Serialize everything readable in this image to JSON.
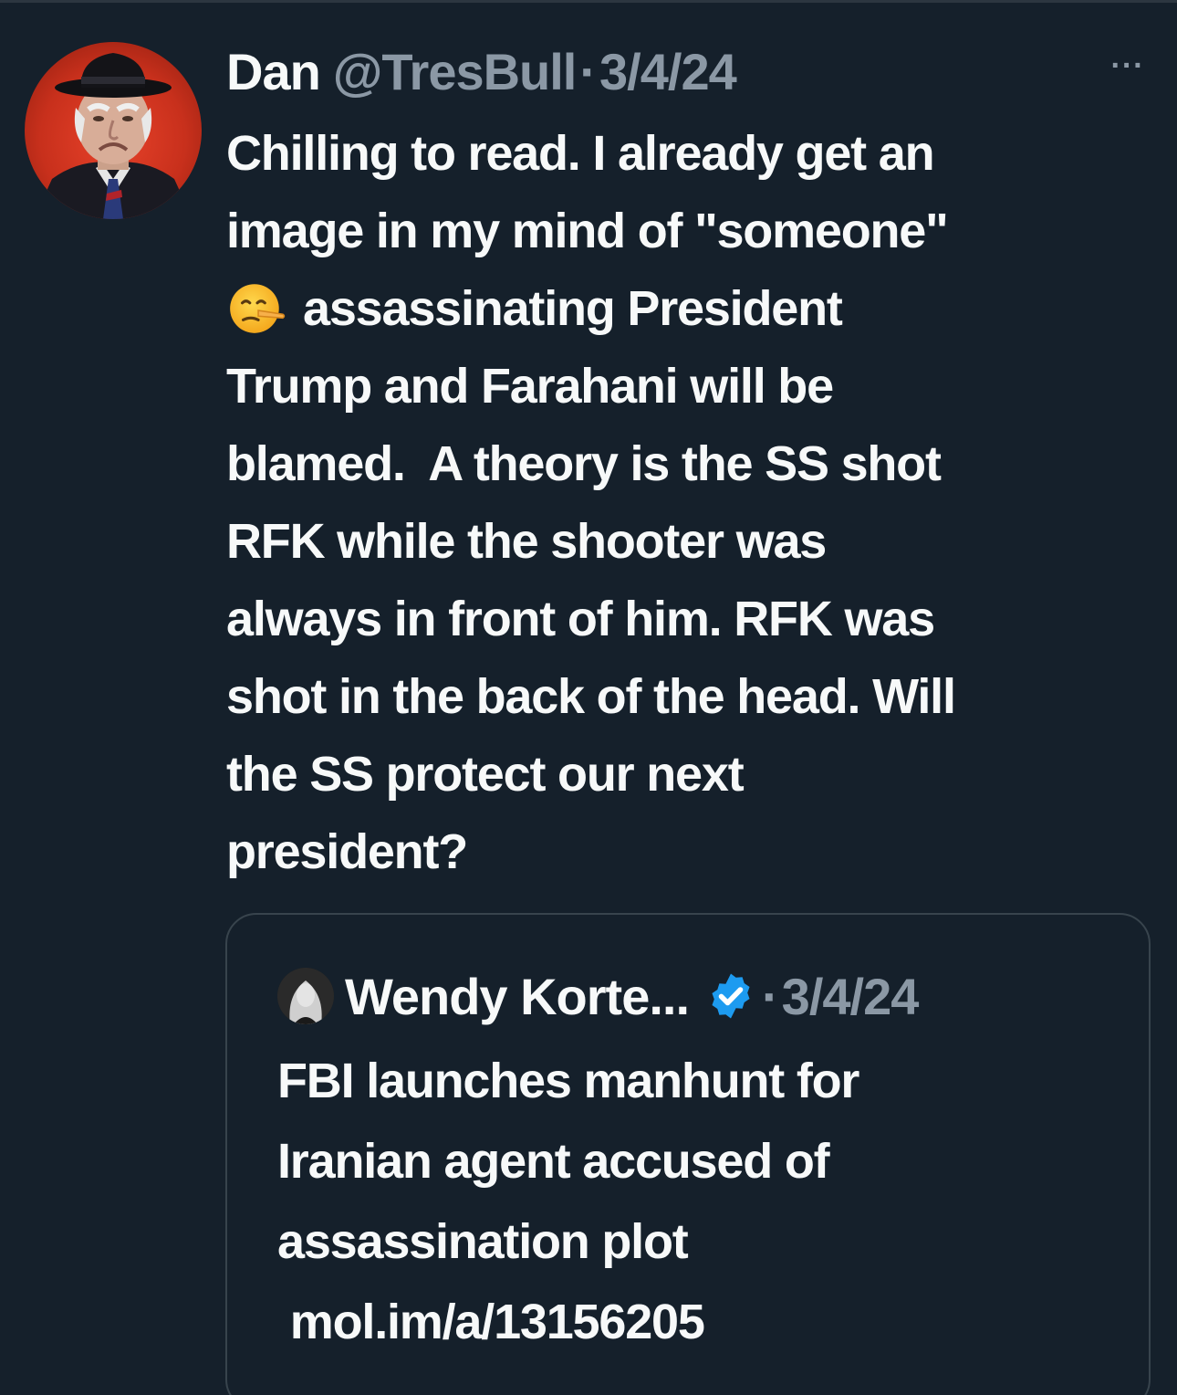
{
  "tweet": {
    "display_name": "Dan",
    "handle": "@TresBull",
    "separator": "·",
    "date": "3/4/24",
    "more_label": "···",
    "text_lines": [
      "Chilling to read. I already get an",
      "image in my mind of \"someone\"",
      "assassinating President",
      "Trump and Farahani will be",
      "blamed.  A theory is the SS shot",
      "RFK while the shooter was",
      "always in front of him. RFK was",
      "shot in the back of the head. Will",
      "the SS protect our next",
      "president?"
    ],
    "inline_emoji": "lying-face-emoji"
  },
  "quoted_tweet": {
    "display_name": "Wendy Korte...",
    "verified": true,
    "separator": "·",
    "date": "3/4/24",
    "text_lines": [
      "FBI launches manhunt for",
      "Iranian agent accused of",
      "assassination plot",
      " mol.im/a/13156205"
    ]
  },
  "colors": {
    "background": "#15202b",
    "primary_text": "#f7f9f9",
    "secondary_text": "#8b98a5",
    "border": "#38444d",
    "verified_badge": "#1d9bf0"
  }
}
